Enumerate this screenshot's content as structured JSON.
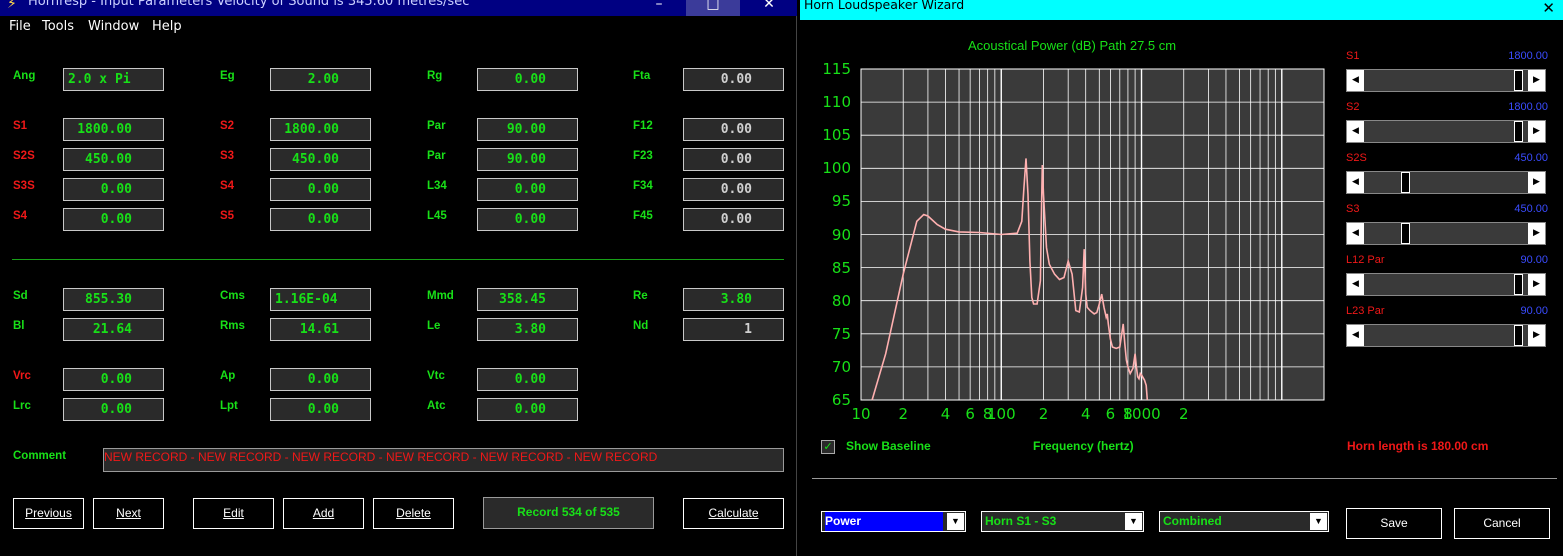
{
  "left_window": {
    "title": "Hornresp - Input Parameters   Velocity of Sound is 345.60 metres/sec",
    "menu": [
      "File",
      "Tools",
      "Window",
      "Help"
    ],
    "fields": {
      "ang": {
        "label": "Ang",
        "value": "2.0 x Pi"
      },
      "eg": {
        "label": "Eg",
        "value": "2.00"
      },
      "rg": {
        "label": "Rg",
        "value": "0.00"
      },
      "fta": {
        "label": "Fta",
        "value": "0.00"
      },
      "s1": {
        "label": "S1",
        "value": "1800.00"
      },
      "s2": {
        "label": "S2",
        "value": "1800.00"
      },
      "par1": {
        "label": "Par",
        "value": "90.00"
      },
      "f12": {
        "label": "F12",
        "value": "0.00"
      },
      "s2s": {
        "label": "S2S",
        "value": "450.00"
      },
      "s3": {
        "label": "S3",
        "value": "450.00"
      },
      "par2": {
        "label": "Par",
        "value": "90.00"
      },
      "f23": {
        "label": "F23",
        "value": "0.00"
      },
      "s3s": {
        "label": "S3S",
        "value": "0.00"
      },
      "s4a": {
        "label": "S4",
        "value": "0.00"
      },
      "l34": {
        "label": "L34",
        "value": "0.00"
      },
      "f34": {
        "label": "F34",
        "value": "0.00"
      },
      "s4b": {
        "label": "S4",
        "value": "0.00"
      },
      "s5": {
        "label": "S5",
        "value": "0.00"
      },
      "l45": {
        "label": "L45",
        "value": "0.00"
      },
      "f45": {
        "label": "F45",
        "value": "0.00"
      },
      "sd": {
        "label": "Sd",
        "value": "855.30"
      },
      "cms": {
        "label": "Cms",
        "value": "1.16E-04"
      },
      "mmd": {
        "label": "Mmd",
        "value": "358.45"
      },
      "re": {
        "label": "Re",
        "value": "3.80"
      },
      "bl": {
        "label": "Bl",
        "value": "21.64"
      },
      "rms": {
        "label": "Rms",
        "value": "14.61"
      },
      "le": {
        "label": "Le",
        "value": "3.80"
      },
      "nd": {
        "label": "Nd",
        "value": "1"
      },
      "vrc": {
        "label": "Vrc",
        "value": "0.00"
      },
      "ap": {
        "label": "Ap",
        "value": "0.00"
      },
      "vtc": {
        "label": "Vtc",
        "value": "0.00"
      },
      "lrc": {
        "label": "Lrc",
        "value": "0.00"
      },
      "lpt": {
        "label": "Lpt",
        "value": "0.00"
      },
      "atc": {
        "label": "Atc",
        "value": "0.00"
      }
    },
    "comment_label": "Comment",
    "comment_value": "NEW RECORD - NEW RECORD - NEW RECORD - NEW RECORD - NEW RECORD - NEW RECORD",
    "buttons": {
      "previous": "Previous",
      "next": "Next",
      "edit": "Edit",
      "add": "Add",
      "delete": "Delete",
      "calculate": "Calculate"
    },
    "record_status": "Record 534 of 535",
    "colors": {
      "label_green": "#18e018",
      "label_red": "#f01818",
      "title_bar": "#000082"
    }
  },
  "right_window": {
    "title": "Horn Loudspeaker Wizard",
    "chart_title": "Acoustical Power (dB)   Path 27.5 cm",
    "sliders": [
      {
        "label": "S1",
        "value": "1800.00",
        "position": 0.97
      },
      {
        "label": "S2",
        "value": "1800.00",
        "position": 0.97
      },
      {
        "label": "S2S",
        "value": "450.00",
        "position": 0.24
      },
      {
        "label": "S3",
        "value": "450.00",
        "position": 0.24
      },
      {
        "label": "L12  Par",
        "value": "90.00",
        "position": 0.97
      },
      {
        "label": "L23  Par",
        "value": "90.00",
        "position": 0.97
      }
    ],
    "show_baseline": {
      "label": "Show Baseline",
      "checked": true
    },
    "xlabel": "Frequency (hertz)",
    "horn_length": "Horn length is 180.00 cm",
    "dropdowns": [
      {
        "value": "Power",
        "selected": true
      },
      {
        "value": "Horn S1 - S3",
        "selected": false
      },
      {
        "value": "Combined",
        "selected": false
      }
    ],
    "buttons": {
      "save": "Save",
      "cancel": "Cancel"
    },
    "colors": {
      "title_bar": "#00ffff",
      "curve": "#ffb0b0",
      "plot_bg": "#3a3a3a",
      "grid": "#ffffff",
      "value_blue": "#3a4cff"
    }
  },
  "chart_data": {
    "type": "line",
    "title": "Acoustical Power (dB)   Path 27.5 cm",
    "xlabel": "Frequency (hertz)",
    "ylabel": "",
    "x_scale": "log",
    "xlim": [
      10,
      20000
    ],
    "ylim": [
      65,
      115
    ],
    "yticks": [
      65,
      70,
      75,
      80,
      85,
      90,
      95,
      100,
      105,
      110,
      115
    ],
    "xtick_labels": [
      "10",
      "2",
      "4",
      "6",
      "8",
      "100",
      "2",
      "4",
      "6",
      "8",
      "1000",
      "2"
    ],
    "grid": true,
    "series": [
      {
        "x": [
          12,
          15,
          20,
          25,
          28,
          30,
          35,
          40,
          50,
          70,
          100,
          130,
          140,
          145,
          150,
          155,
          160,
          165,
          170,
          180,
          190,
          193,
          196,
          200,
          210,
          220,
          240,
          260,
          280,
          300,
          320,
          340,
          360,
          380,
          390,
          400,
          410,
          430,
          460,
          480,
          500,
          520,
          540,
          560,
          570,
          580,
          600,
          620,
          660,
          700,
          740,
          760,
          780,
          800,
          830,
          870,
          900,
          920,
          940,
          960,
          980,
          1000,
          1050,
          1080,
          1100
        ],
        "y": [
          65,
          72,
          84,
          92,
          93,
          92.8,
          91.5,
          90.8,
          90.4,
          90.3,
          90,
          90.2,
          92,
          97,
          101.5,
          96,
          86,
          80.5,
          79.5,
          79.5,
          83,
          92,
          100.5,
          96,
          88,
          85.5,
          84,
          83.2,
          83.5,
          86,
          84,
          78.5,
          78.3,
          82,
          87.8,
          81,
          79,
          78.5,
          78,
          78.2,
          79.5,
          81,
          79,
          77.5,
          78,
          76.5,
          74.2,
          73,
          72.8,
          73,
          76.5,
          73.5,
          71,
          70,
          69,
          69.8,
          72,
          70,
          68.5,
          68.2,
          69,
          68.8,
          68,
          67.2,
          65
        ]
      }
    ]
  }
}
